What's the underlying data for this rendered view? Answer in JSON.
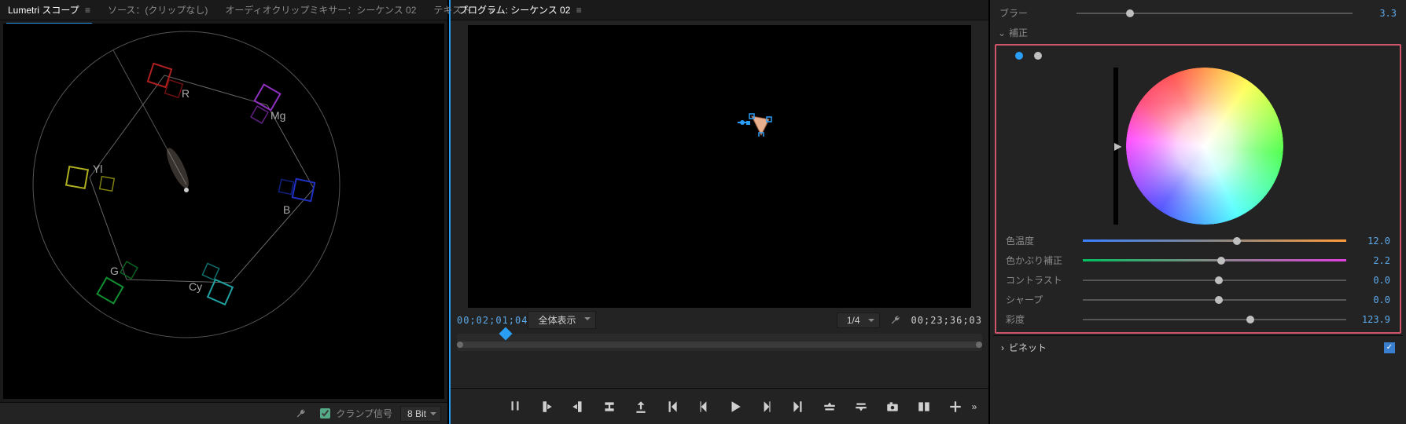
{
  "scopes": {
    "tabs": {
      "lumetri_scope": "Lumetri スコープ",
      "source": "ソース：(クリップなし)",
      "audio_mixer": "オーディオクリップミキサー：シーケンス 02",
      "text": "テキスト"
    },
    "vec_labels": {
      "R": "R",
      "Mg": "Mg",
      "B": "B",
      "Cy": "Cy",
      "G": "G",
      "Yl": "Yl"
    },
    "footer": {
      "clamp_label": "クランプ信号",
      "bitdepth": "8 Bit"
    }
  },
  "program": {
    "tab_label": "プログラム: シーケンス 02",
    "current_tc": "00;02;01;04",
    "zoom_label": "全体表示",
    "scale_label": "1/4",
    "duration_tc": "00;23;36;03"
  },
  "lumetri": {
    "blur": {
      "label": "ブラー",
      "value": "3.3",
      "pos": 18
    },
    "correction_header": "補正",
    "temp": {
      "label": "色温度",
      "value": "12.0",
      "pos": 57
    },
    "tint": {
      "label": "色かぶり補正",
      "value": "2.2",
      "pos": 51
    },
    "contrast": {
      "label": "コントラスト",
      "value": "0.0",
      "pos": 50
    },
    "sharpen": {
      "label": "シャープ",
      "value": "0.0",
      "pos": 50
    },
    "saturation": {
      "label": "彩度",
      "value": "123.9",
      "pos": 62
    },
    "vignette": "ビネット"
  }
}
